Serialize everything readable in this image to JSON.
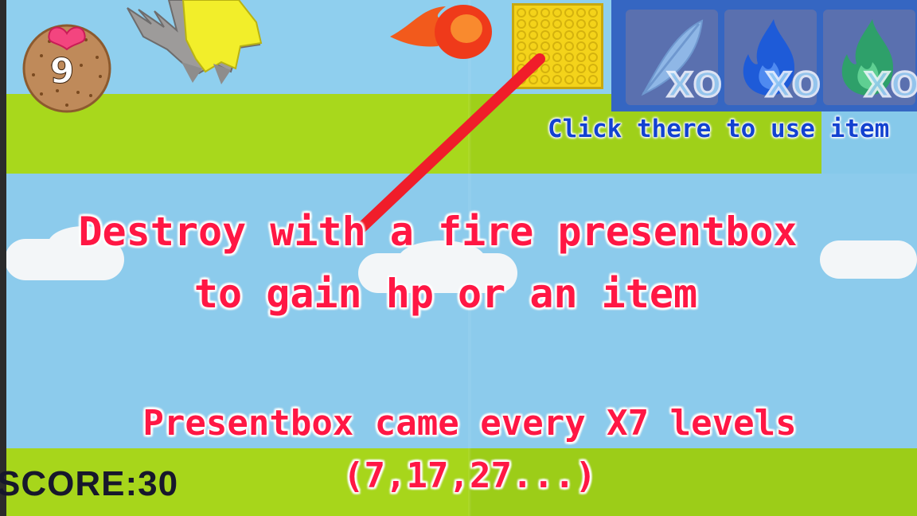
{
  "hud": {
    "lives": "9",
    "score": "SCORE:30"
  },
  "items": [
    {
      "name": "feather",
      "icon": "feather-icon",
      "count": "XO",
      "color": "#8fb7e6"
    },
    {
      "name": "blue-fire",
      "icon": "blue-flame-icon",
      "count": "XO",
      "color": "#1e5bd8"
    },
    {
      "name": "green-fire",
      "icon": "green-flame-icon",
      "count": "XO",
      "color": "#2ea06a"
    }
  ],
  "tutorial": {
    "item_hint": "Click there to use item",
    "line1": "Destroy with a fire presentbox",
    "line2": "to gain hp or an item",
    "line3": "Presentbox came every X7 levels",
    "line4": "(7,17,27...)"
  },
  "colors": {
    "tutorial_text": "#ff1744",
    "hint_text": "#1342d0",
    "pointer": "#f01d2a",
    "present_box": "#f4d31a"
  }
}
